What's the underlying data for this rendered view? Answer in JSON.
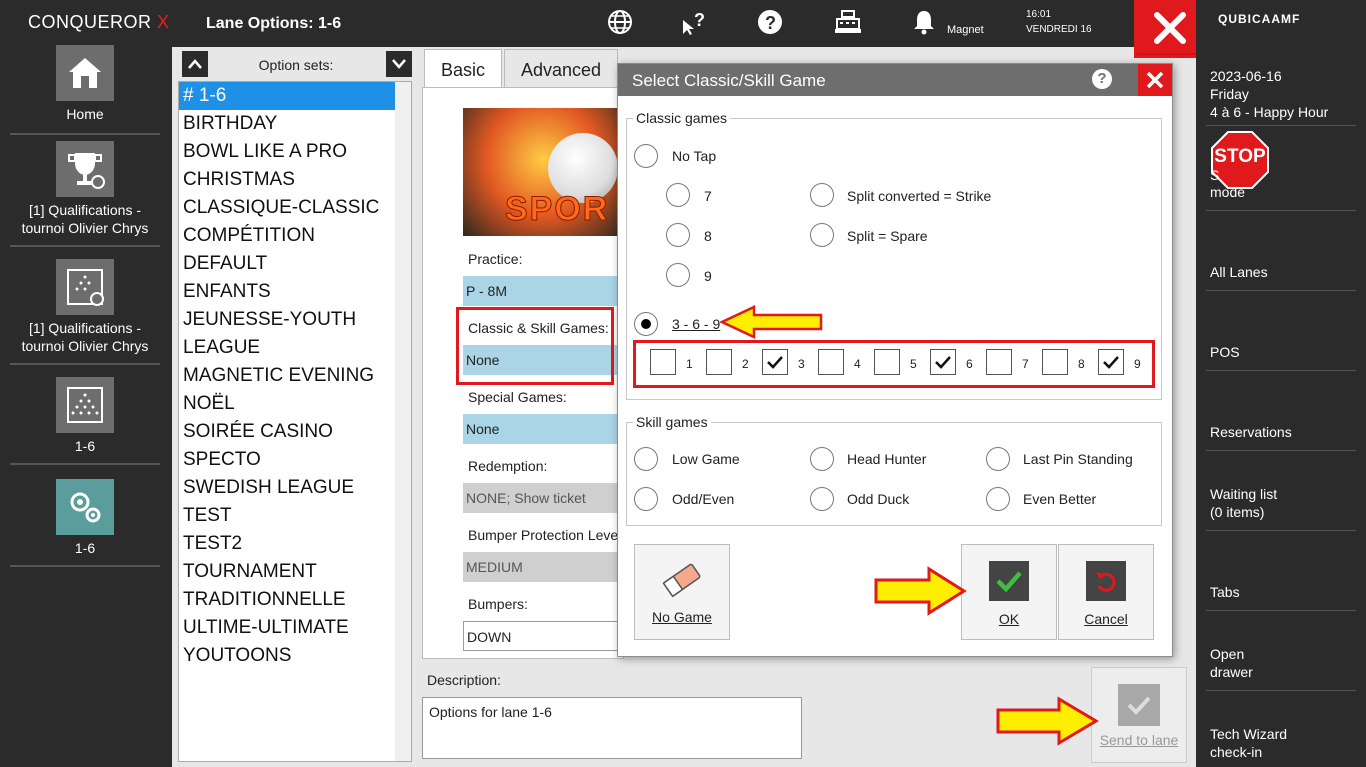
{
  "app": {
    "brand": "CONQUEROR",
    "brand_x": "X"
  },
  "left_nav": [
    {
      "label": "Home"
    },
    {
      "label": "[1] Qualifications - tournoi Olivier Chrys"
    },
    {
      "label": "[1] Qualifications - tournoi Olivier Chrys"
    },
    {
      "label": "1-6"
    },
    {
      "label": "1-6"
    }
  ],
  "topbar": {
    "title": "Lane Options: 1-6",
    "magnet": "Magnet",
    "time": "16:01",
    "date": "VENDREDI 16"
  },
  "right": {
    "logo": "QUBICAAMF",
    "date": "2023-06-16",
    "day": "Friday",
    "event": "4 à 6 - Happy Hour",
    "stop_badge": "STOP",
    "stop_mode_frag": "S",
    "stop_mode": "mode",
    "items": [
      "All Lanes",
      "POS",
      "Reservations",
      "Waiting list",
      "(0 items)",
      "Tabs",
      "Open",
      "drawer",
      "Tech Wizard",
      "check-in"
    ]
  },
  "option_sets": {
    "title": "Option sets:",
    "items": [
      "# 1-6",
      "BIRTHDAY",
      "BOWL LIKE A PRO",
      "CHRISTMAS",
      "CLASSIQUE-CLASSIC",
      "COMPÉTITION",
      "DEFAULT",
      "ENFANTS",
      "JEUNESSE-YOUTH",
      "LEAGUE",
      "MAGNETIC EVENING",
      "NOËL",
      "SOIRÉE CASINO",
      "SPECTO",
      "SWEDISH LEAGUE",
      "TEST",
      "TEST2",
      "TOURNAMENT",
      "TRADITIONNELLE",
      "ULTIME-ULTIMATE",
      "YOUTOONS"
    ]
  },
  "tabs": {
    "basic": "Basic",
    "advanced": "Advanced"
  },
  "fields": {
    "sport_text": "SPOR",
    "practice_label": "Practice:",
    "practice_value": "P - 8M",
    "classic_label": "Classic & Skill Games:",
    "classic_value": "None",
    "special_label": "Special Games:",
    "special_value": "None",
    "redemption_label": "Redemption:",
    "redemption_value": "NONE; Show ticket",
    "bumper_prot_label": "Bumper Protection Level",
    "bumper_prot_value": "MEDIUM",
    "bumpers_label": "Bumpers:",
    "bumpers_value": "DOWN"
  },
  "description": {
    "label": "Description:",
    "value": "Options for lane 1-6"
  },
  "send_label": "Send to lane",
  "dialog": {
    "title": "Select Classic/Skill Game",
    "help": "?",
    "classic_legend": "Classic games",
    "no_tap": "No Tap",
    "no_tap_opts": [
      "7",
      "8",
      "9"
    ],
    "split_converted": "Split converted = Strike",
    "split_spare": "Split = Spare",
    "three_six_nine": "3 - 6 - 9",
    "pins": [
      {
        "n": "1",
        "checked": false
      },
      {
        "n": "2",
        "checked": false
      },
      {
        "n": "3",
        "checked": true
      },
      {
        "n": "4",
        "checked": false
      },
      {
        "n": "5",
        "checked": false
      },
      {
        "n": "6",
        "checked": true
      },
      {
        "n": "7",
        "checked": false
      },
      {
        "n": "8",
        "checked": false
      },
      {
        "n": "9",
        "checked": true
      }
    ],
    "skill_legend": "Skill games",
    "skill": [
      "Low Game",
      "Head Hunter",
      "Last Pin Standing",
      "Odd/Even",
      "Odd Duck",
      "Even Better"
    ],
    "no_game": "No Game",
    "ok": "OK",
    "cancel": "Cancel"
  }
}
